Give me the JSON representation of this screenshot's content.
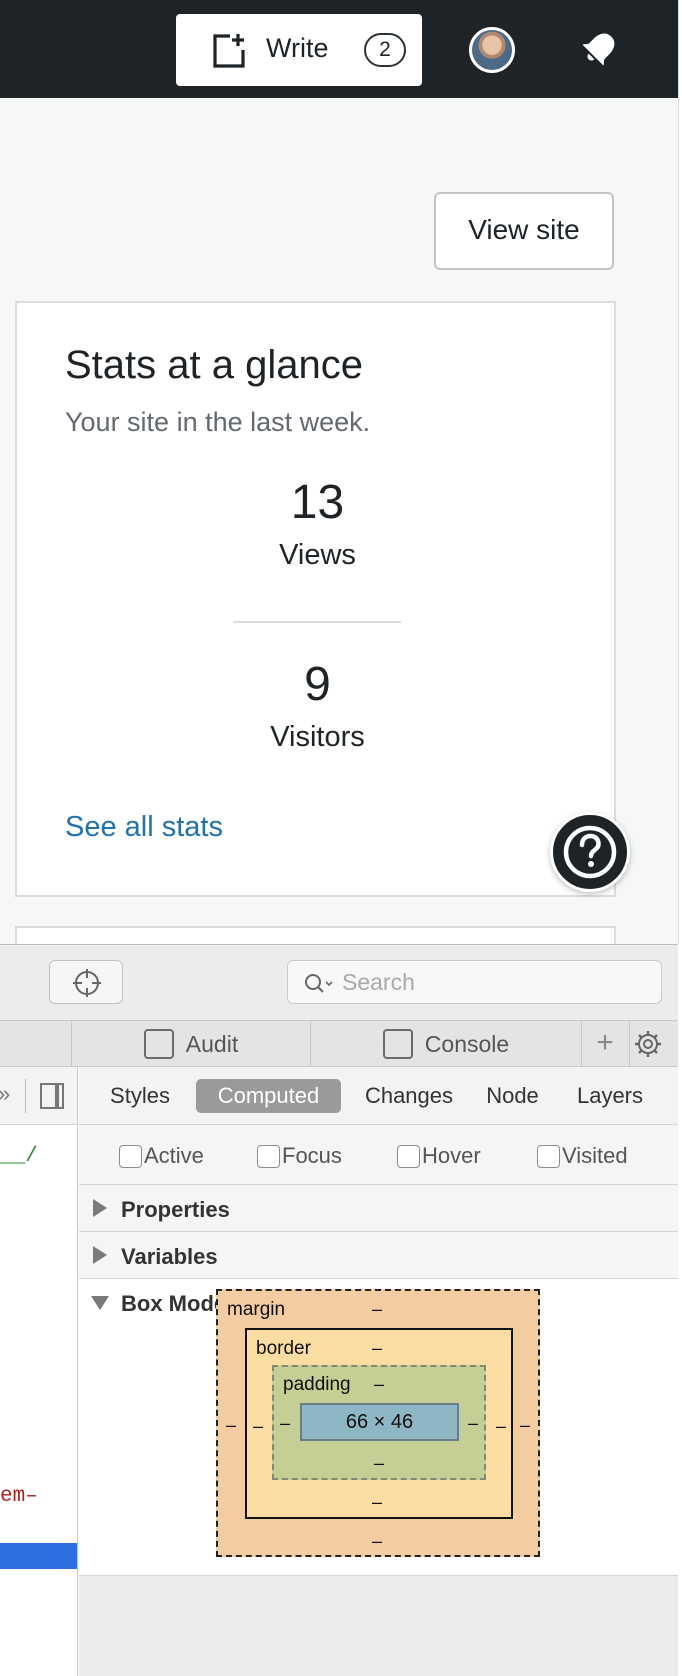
{
  "masterbar": {
    "write_label": "Write",
    "write_count": "2",
    "icons": [
      "write-icon",
      "avatar",
      "notifications-bell-icon"
    ]
  },
  "page": {
    "view_site_label": "View site",
    "stats": {
      "title": "Stats at a glance",
      "subtitle": "Your site in the last week.",
      "views_value": "13",
      "views_label": "Views",
      "visitors_value": "9",
      "visitors_label": "Visitors",
      "see_all_label": "See all stats"
    },
    "help_icon": "question-mark-icon"
  },
  "devtools": {
    "search_placeholder": "Search",
    "tabs": [
      {
        "label": "Audit",
        "icon": "audit-icon"
      },
      {
        "label": "Console",
        "icon": "console-icon"
      }
    ],
    "dom_snippets": [
      "__/",
      "em–"
    ],
    "sidebar_tabs": [
      "Styles",
      "Computed",
      "Changes",
      "Node",
      "Layers"
    ],
    "active_sidebar_tab": "Computed",
    "pseudo_classes": [
      "Active",
      "Focus",
      "Hover",
      "Visited"
    ],
    "sections": [
      {
        "label": "Properties",
        "expanded": false
      },
      {
        "label": "Variables",
        "expanded": false
      },
      {
        "label": "Box Model",
        "expanded": true
      }
    ],
    "box_model": {
      "margin_label": "margin",
      "border_label": "border",
      "padding_label": "padding",
      "content_size": "66 × 46",
      "empty_value": "–"
    }
  },
  "colors": {
    "masterbar_bg": "#1d2327",
    "link": "#2271b1",
    "page_bg": "#f6f7f7",
    "dom_selection": "#2c6fe0",
    "margin": "#f4cca1",
    "border": "#fbdda1",
    "padding": "#c5ce95",
    "content": "#8eb6c4"
  }
}
